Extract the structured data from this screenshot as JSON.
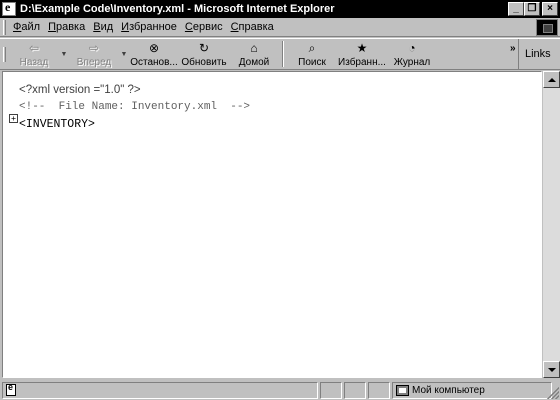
{
  "window": {
    "title": "D:\\Example Code\\Inventory.xml - Microsoft Internet Explorer",
    "minimize": "_",
    "restore": "❐",
    "close": "×"
  },
  "menu": [
    {
      "key": "Ф",
      "rest": "айл"
    },
    {
      "key": "П",
      "rest": "равка"
    },
    {
      "key": "В",
      "rest": "ид"
    },
    {
      "key": "И",
      "rest": "збранное"
    },
    {
      "key": "С",
      "rest": "ервис"
    },
    {
      "key": "С",
      "rest": "правка"
    }
  ],
  "toolbar": {
    "back": {
      "label": "Назад",
      "icon": "back-arrow-icon",
      "glyph": "⇦"
    },
    "forward": {
      "label": "Вперед",
      "icon": "forward-arrow-icon",
      "glyph": "⇨"
    },
    "stop": {
      "label": "Останов...",
      "icon": "stop-icon",
      "glyph": "⊗"
    },
    "refresh": {
      "label": "Обновить",
      "icon": "refresh-icon",
      "glyph": "↻"
    },
    "home": {
      "label": "Домой",
      "icon": "home-icon",
      "glyph": "⌂"
    },
    "search": {
      "label": "Поиск",
      "icon": "search-icon",
      "glyph": "⌕"
    },
    "favorites": {
      "label": "Избранн...",
      "icon": "favorites-icon",
      "glyph": "★"
    },
    "history": {
      "label": "Журнал",
      "icon": "history-icon",
      "glyph": "◔"
    },
    "more": "»",
    "links": "Links"
  },
  "content": {
    "line1": "<?xml version =\"1.0\" ?>",
    "line2": "<!--  File Name: Inventory.xml  -->",
    "line3": "<INVENTORY>",
    "expander": "+"
  },
  "status": {
    "zone": "Мой компьютер"
  }
}
